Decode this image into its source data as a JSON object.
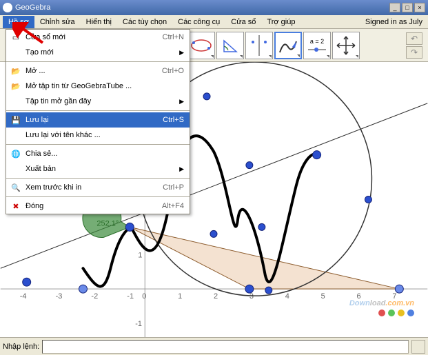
{
  "title": "GeoGebra",
  "menubar": {
    "items": [
      "Hồ sơ",
      "Chỉnh sửa",
      "Hiển thị",
      "Các tùy chọn",
      "Các công cụ",
      "Cửa sổ",
      "Trợ giúp"
    ],
    "signed_in": "Signed in as July"
  },
  "toolbar": {
    "slider_label": "a = 2"
  },
  "dropdown": {
    "items": [
      {
        "icon": "window-new",
        "label": "Cửa sổ mới",
        "shortcut": "Ctrl+N"
      },
      {
        "icon": "",
        "label": "Tạo mới",
        "submenu": true
      },
      {
        "sep": true
      },
      {
        "icon": "folder-open",
        "label": "Mở ...",
        "shortcut": "Ctrl+O"
      },
      {
        "icon": "folder-open",
        "label": "Mở tập tin từ GeoGebraTube ..."
      },
      {
        "icon": "",
        "label": "Tập tin mở gần đây",
        "submenu": true
      },
      {
        "sep": true
      },
      {
        "icon": "save",
        "label": "Lưu lại",
        "shortcut": "Ctrl+S",
        "highlighted": true
      },
      {
        "icon": "",
        "label": "Lưu lại với tên khác ..."
      },
      {
        "sep": true
      },
      {
        "icon": "share",
        "label": "Chia sẻ..."
      },
      {
        "icon": "",
        "label": "Xuất bản",
        "submenu": true
      },
      {
        "sep": true
      },
      {
        "icon": "preview",
        "label": "Xem trước khi in",
        "shortcut": "Ctrl+P"
      },
      {
        "sep": true
      },
      {
        "icon": "close",
        "label": "Đóng",
        "shortcut": "Alt+F4"
      }
    ]
  },
  "input": {
    "label": "Nhập lệnh:"
  },
  "canvas": {
    "angle_label": "252.1°",
    "x_ticks": [
      "-4",
      "-3",
      "-2",
      "-1",
      "0",
      "1",
      "2",
      "3",
      "4",
      "5",
      "6",
      "7"
    ],
    "y_ticks": [
      "-1",
      "1"
    ]
  },
  "watermark": {
    "part1": "Down",
    "part2": "load",
    "part3": ".com.vn"
  },
  "dots_colors": [
    "#e05050",
    "#5ac45a",
    "#e8c020",
    "#5080e0"
  ]
}
